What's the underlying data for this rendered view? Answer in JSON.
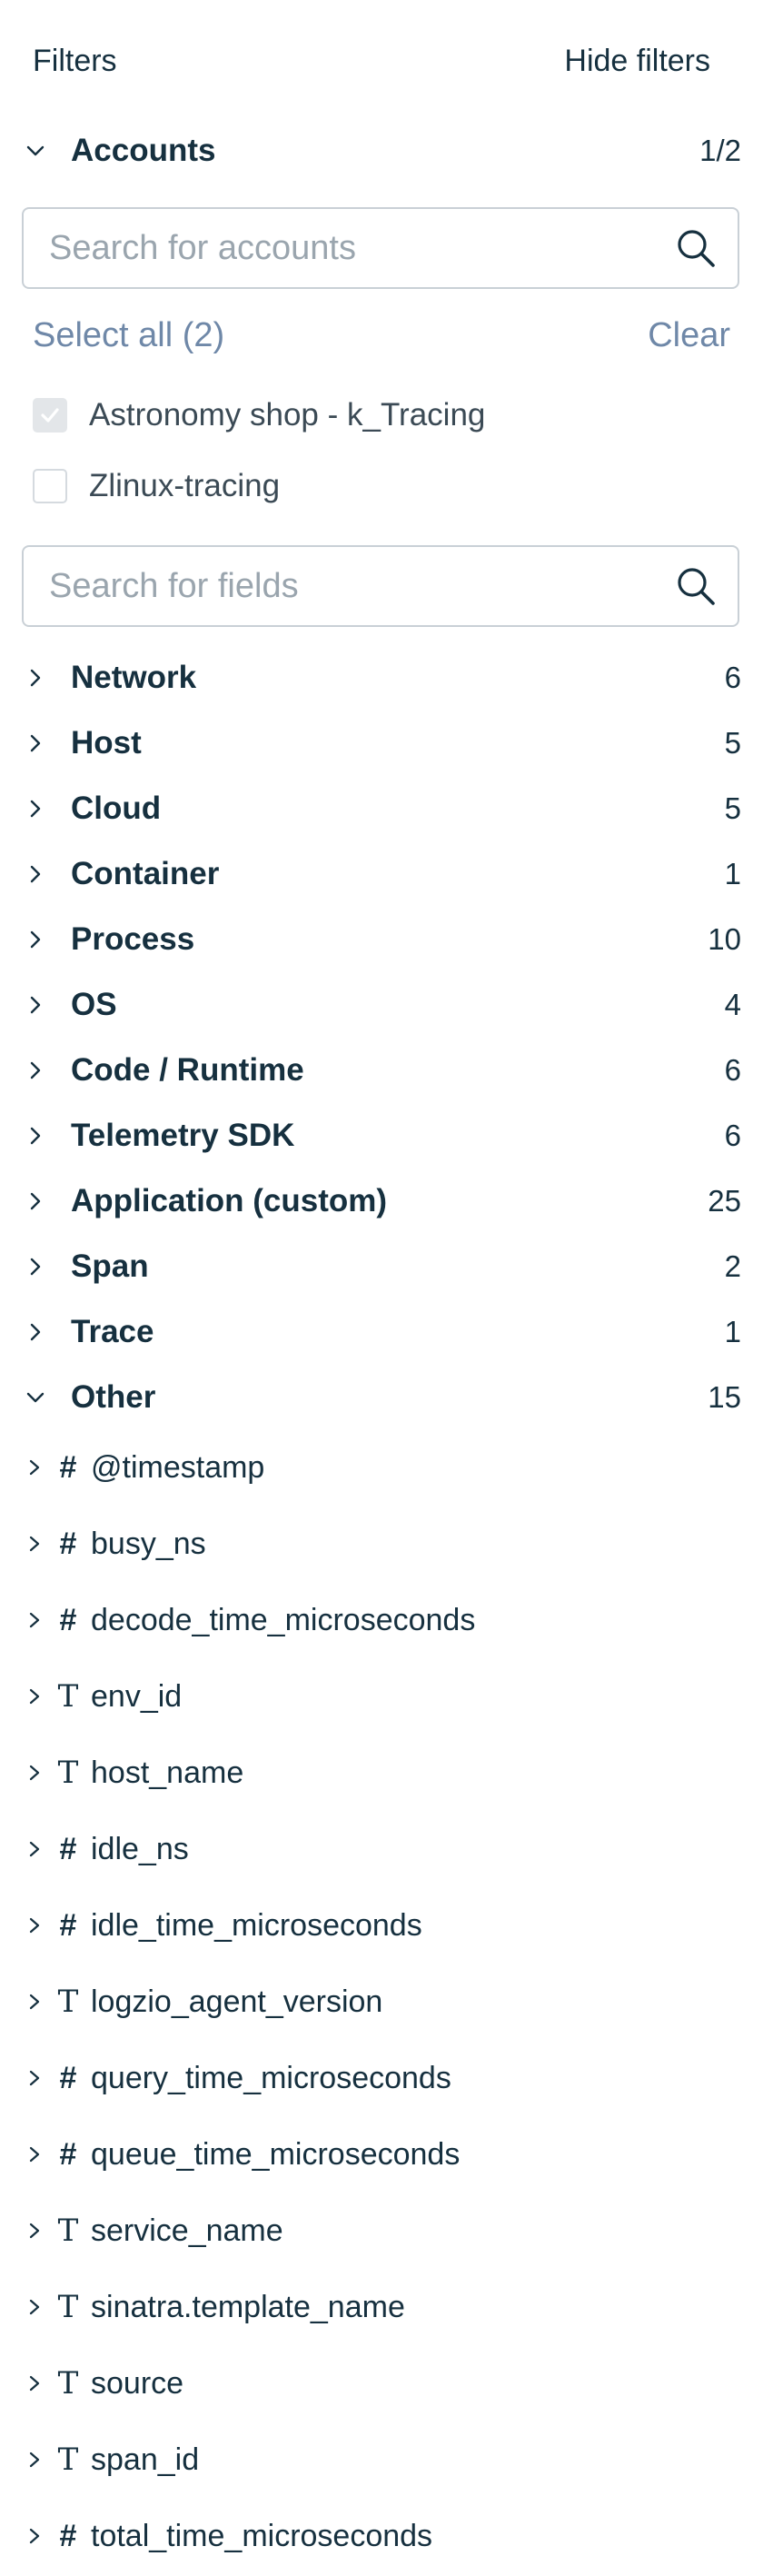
{
  "header": {
    "title": "Filters",
    "hide_filters": "Hide filters"
  },
  "accounts": {
    "label": "Accounts",
    "count": "1/2",
    "search_placeholder": "Search for accounts",
    "select_all": "Select all (2)",
    "clear": "Clear",
    "items": [
      {
        "label": "Astronomy shop - k_Tracing",
        "checked": true
      },
      {
        "label": "Zlinux-tracing",
        "checked": false
      }
    ]
  },
  "fields_search_placeholder": "Search for fields",
  "categories": [
    {
      "label": "Network",
      "count": "6",
      "expanded": false
    },
    {
      "label": "Host",
      "count": "5",
      "expanded": false
    },
    {
      "label": "Cloud",
      "count": "5",
      "expanded": false
    },
    {
      "label": "Container",
      "count": "1",
      "expanded": false
    },
    {
      "label": "Process",
      "count": "10",
      "expanded": false
    },
    {
      "label": "OS",
      "count": "4",
      "expanded": false
    },
    {
      "label": "Code / Runtime",
      "count": "6",
      "expanded": false
    },
    {
      "label": "Telemetry SDK",
      "count": "6",
      "expanded": false
    },
    {
      "label": "Application (custom)",
      "count": "25",
      "expanded": false
    },
    {
      "label": "Span",
      "count": "2",
      "expanded": false
    },
    {
      "label": "Trace",
      "count": "1",
      "expanded": false
    },
    {
      "label": "Other",
      "count": "15",
      "expanded": true
    }
  ],
  "other_fields": [
    {
      "type": "#",
      "label": "@timestamp"
    },
    {
      "type": "#",
      "label": "busy_ns"
    },
    {
      "type": "#",
      "label": "decode_time_microseconds"
    },
    {
      "type": "T",
      "label": "env_id"
    },
    {
      "type": "T",
      "label": "host_name"
    },
    {
      "type": "#",
      "label": "idle_ns"
    },
    {
      "type": "#",
      "label": "idle_time_microseconds"
    },
    {
      "type": "T",
      "label": "logzio_agent_version"
    },
    {
      "type": "#",
      "label": "query_time_microseconds"
    },
    {
      "type": "#",
      "label": "queue_time_microseconds"
    },
    {
      "type": "T",
      "label": "service_name"
    },
    {
      "type": "T",
      "label": "sinatra.template_name"
    },
    {
      "type": "T",
      "label": "source"
    },
    {
      "type": "T",
      "label": "span_id"
    },
    {
      "type": "#",
      "label": "total_time_microseconds"
    }
  ],
  "colors": {
    "text": "#16303f",
    "link": "#6f88a8",
    "border": "#c9d0d6",
    "placeholder": "#9aa5ae"
  }
}
